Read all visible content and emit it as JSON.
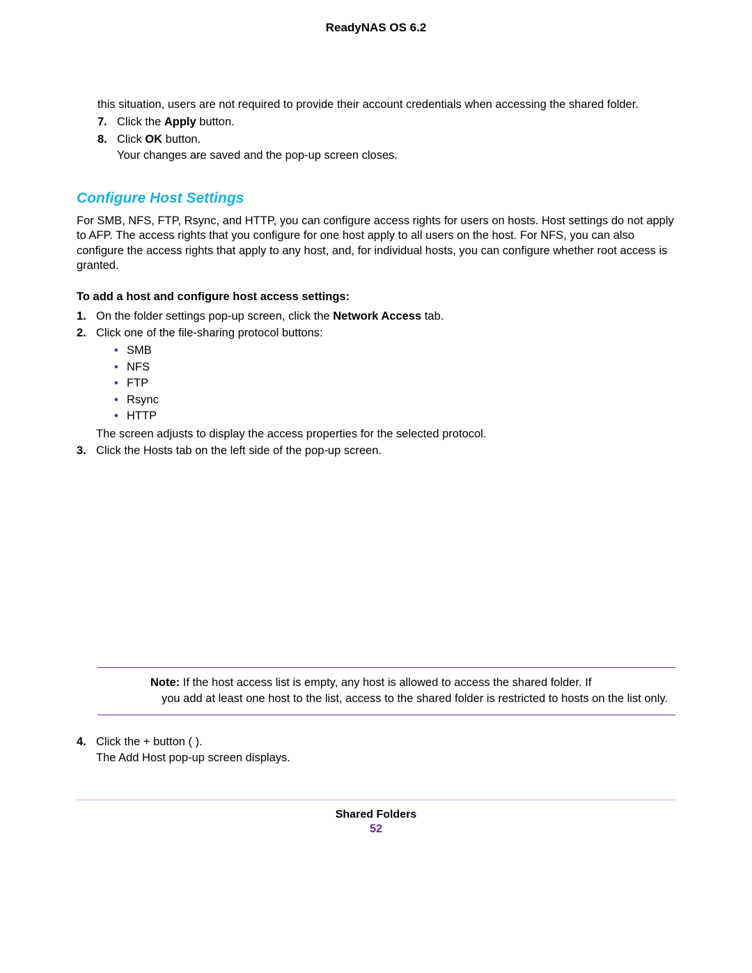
{
  "header": {
    "title": "ReadyNAS OS 6.2"
  },
  "intro": {
    "cont_text": "this situation, users are not required to provide their account credentials when accessing the shared folder."
  },
  "steps_top": {
    "s7": {
      "num": "7.",
      "pre": "Click the ",
      "bold": "Apply",
      "post": " button."
    },
    "s8": {
      "num": "8.",
      "pre": "Click ",
      "bold": "OK",
      "post": " button.",
      "extra": "Your changes are saved and the pop-up screen closes."
    }
  },
  "section": {
    "heading": "Configure Host Settings",
    "para": "For SMB, NFS, FTP, Rsync, and HTTP, you can configure access rights for users on hosts. Host settings do not apply to AFP. The access rights that you configure for one host apply to all users on the host. For NFS, you can also configure the access rights that apply to any host, and, for individual hosts, you can configure whether root access is granted.",
    "subhead": "To add a host and configure host access settings:"
  },
  "steps_mid": {
    "s1": {
      "num": "1.",
      "pre": "On the folder settings pop-up screen, click the ",
      "bold": "Network Access",
      "post": " tab."
    },
    "s2": {
      "num": "2.",
      "text": "Click one of the file-sharing protocol buttons:",
      "bullets": [
        "SMB",
        "NFS",
        "FTP",
        "Rsync",
        "HTTP"
      ],
      "after": "The screen adjusts to display the access properties for the selected protocol."
    },
    "s3": {
      "num": "3.",
      "text": "Click the Hosts tab on the left side of the pop-up screen."
    }
  },
  "note": {
    "label": "Note:",
    "text_line1": "If the host access list is empty, any host is allowed to access the shared folder. If",
    "text_line2": "you add at least one host to the list, access to the shared folder is restricted to hosts on the list only."
  },
  "steps_bottom": {
    "s4": {
      "num": "4.",
      "text": "Click the + button (   ).",
      "extra": "The Add Host pop-up screen displays."
    }
  },
  "footer": {
    "section": "Shared Folders",
    "page": "52"
  }
}
